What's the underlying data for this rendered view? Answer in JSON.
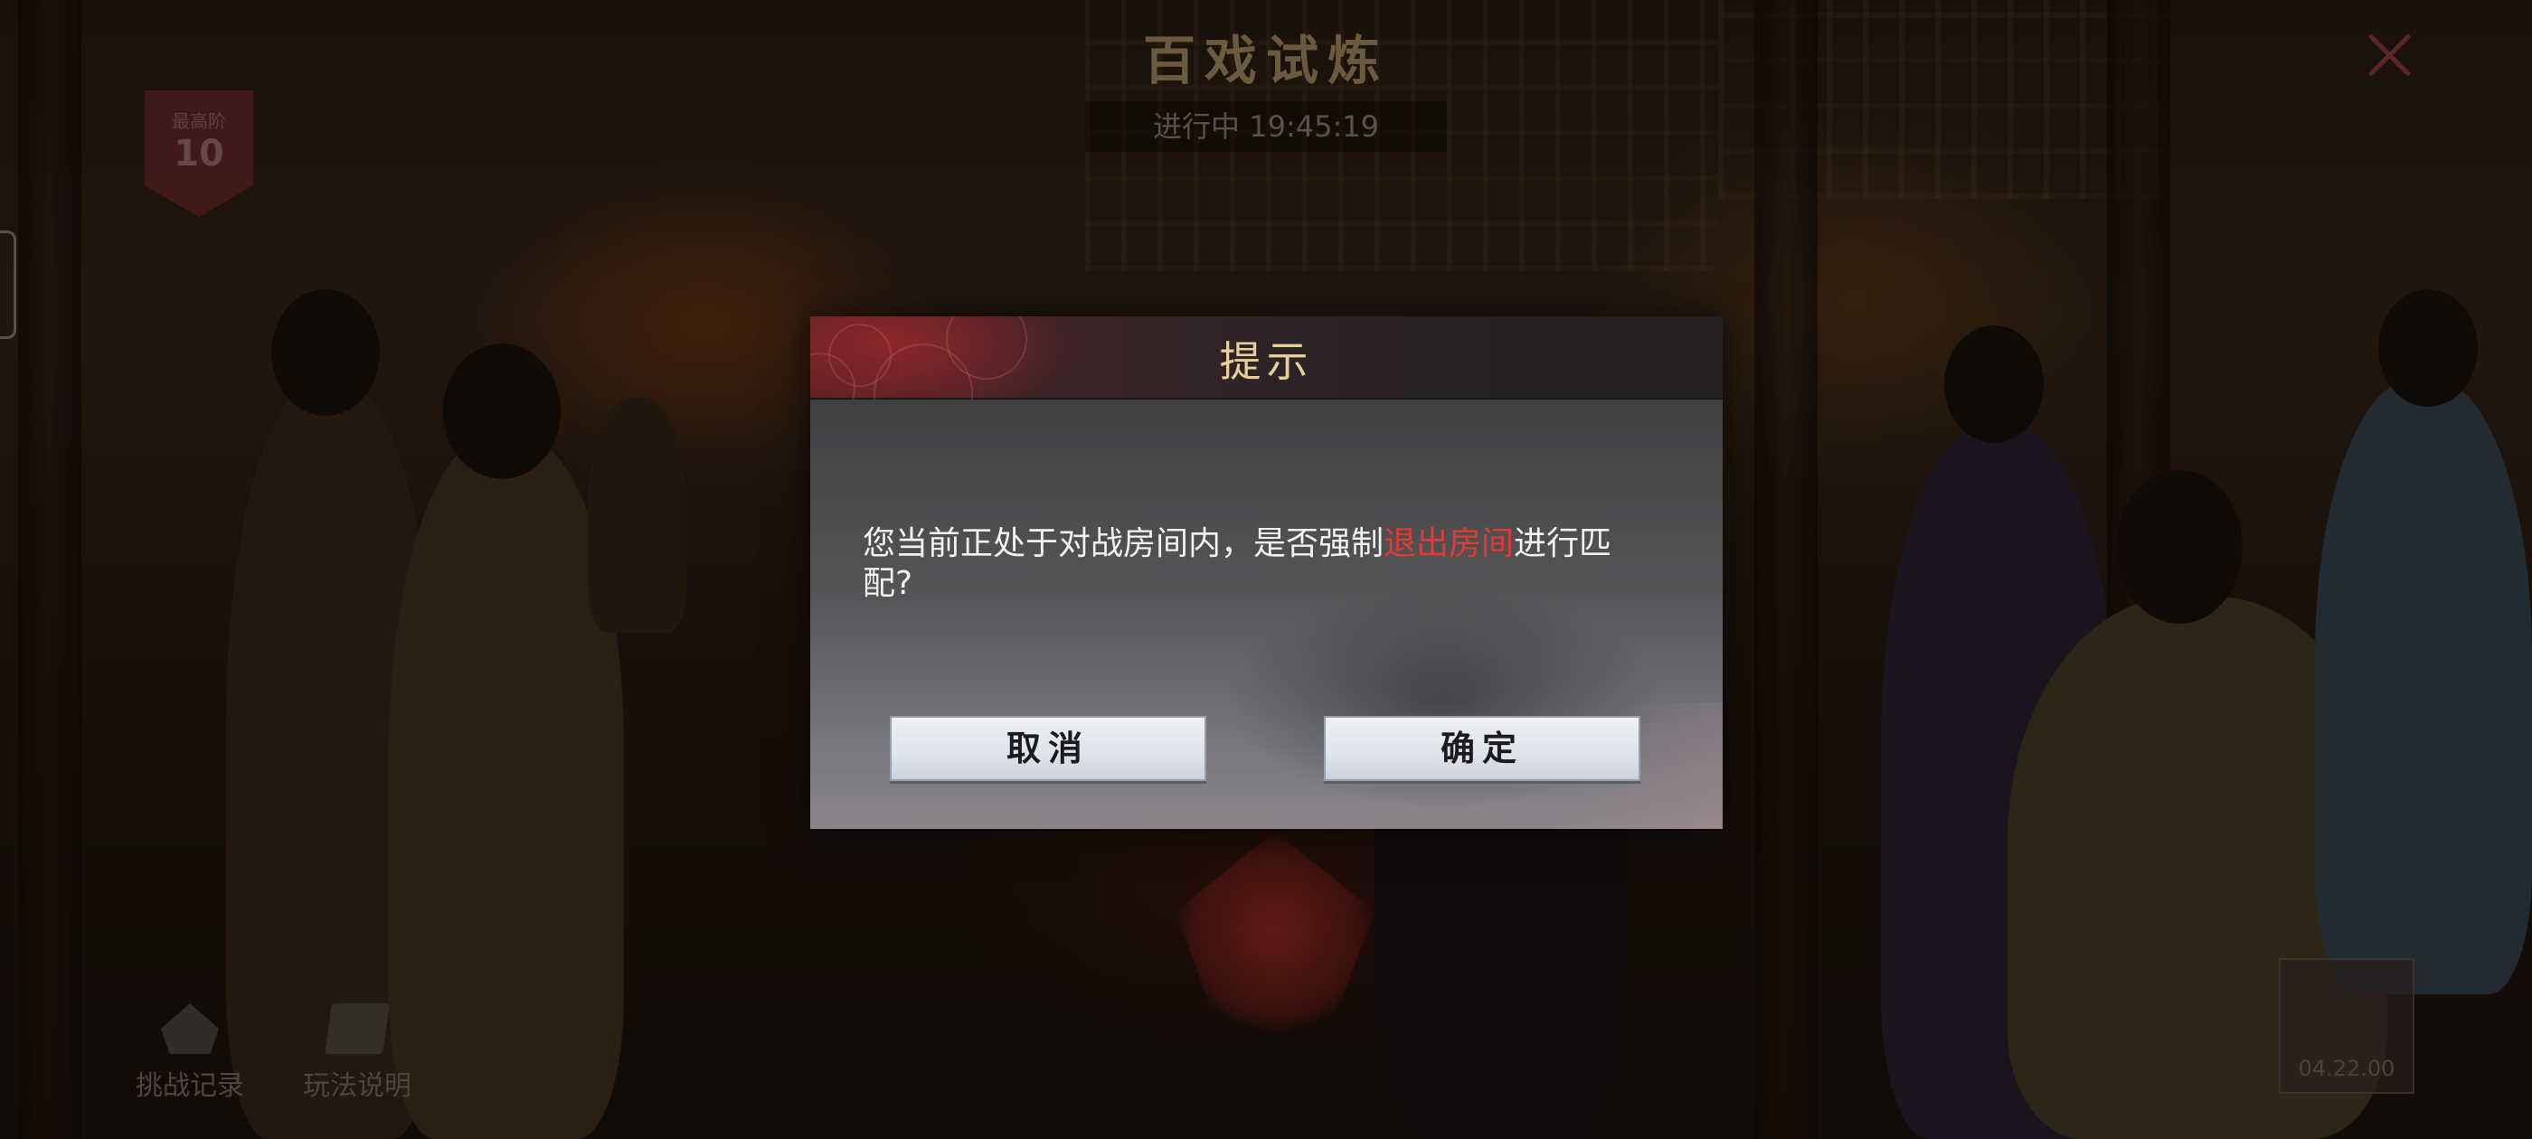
{
  "hud": {
    "title": "百戏试炼",
    "status": "进行中 19:45:19",
    "rank_label": "最高阶",
    "rank_value": "10",
    "bottom_buttons": [
      {
        "label": "挑战记录",
        "icon": "pencil-icon"
      },
      {
        "label": "玩法说明",
        "icon": "book-icon"
      }
    ],
    "corner_text": "04.22.00"
  },
  "dialog": {
    "title": "提示",
    "message_before": "您当前正处于对战房间内，是否强制",
    "message_highlight": "退出房间",
    "message_after": "进行匹配?",
    "cancel_label": "取消",
    "confirm_label": "确定"
  },
  "colors": {
    "highlight": "#e23a34",
    "title_gold": "#e7cf9a",
    "header_red": "#5a1f22"
  }
}
